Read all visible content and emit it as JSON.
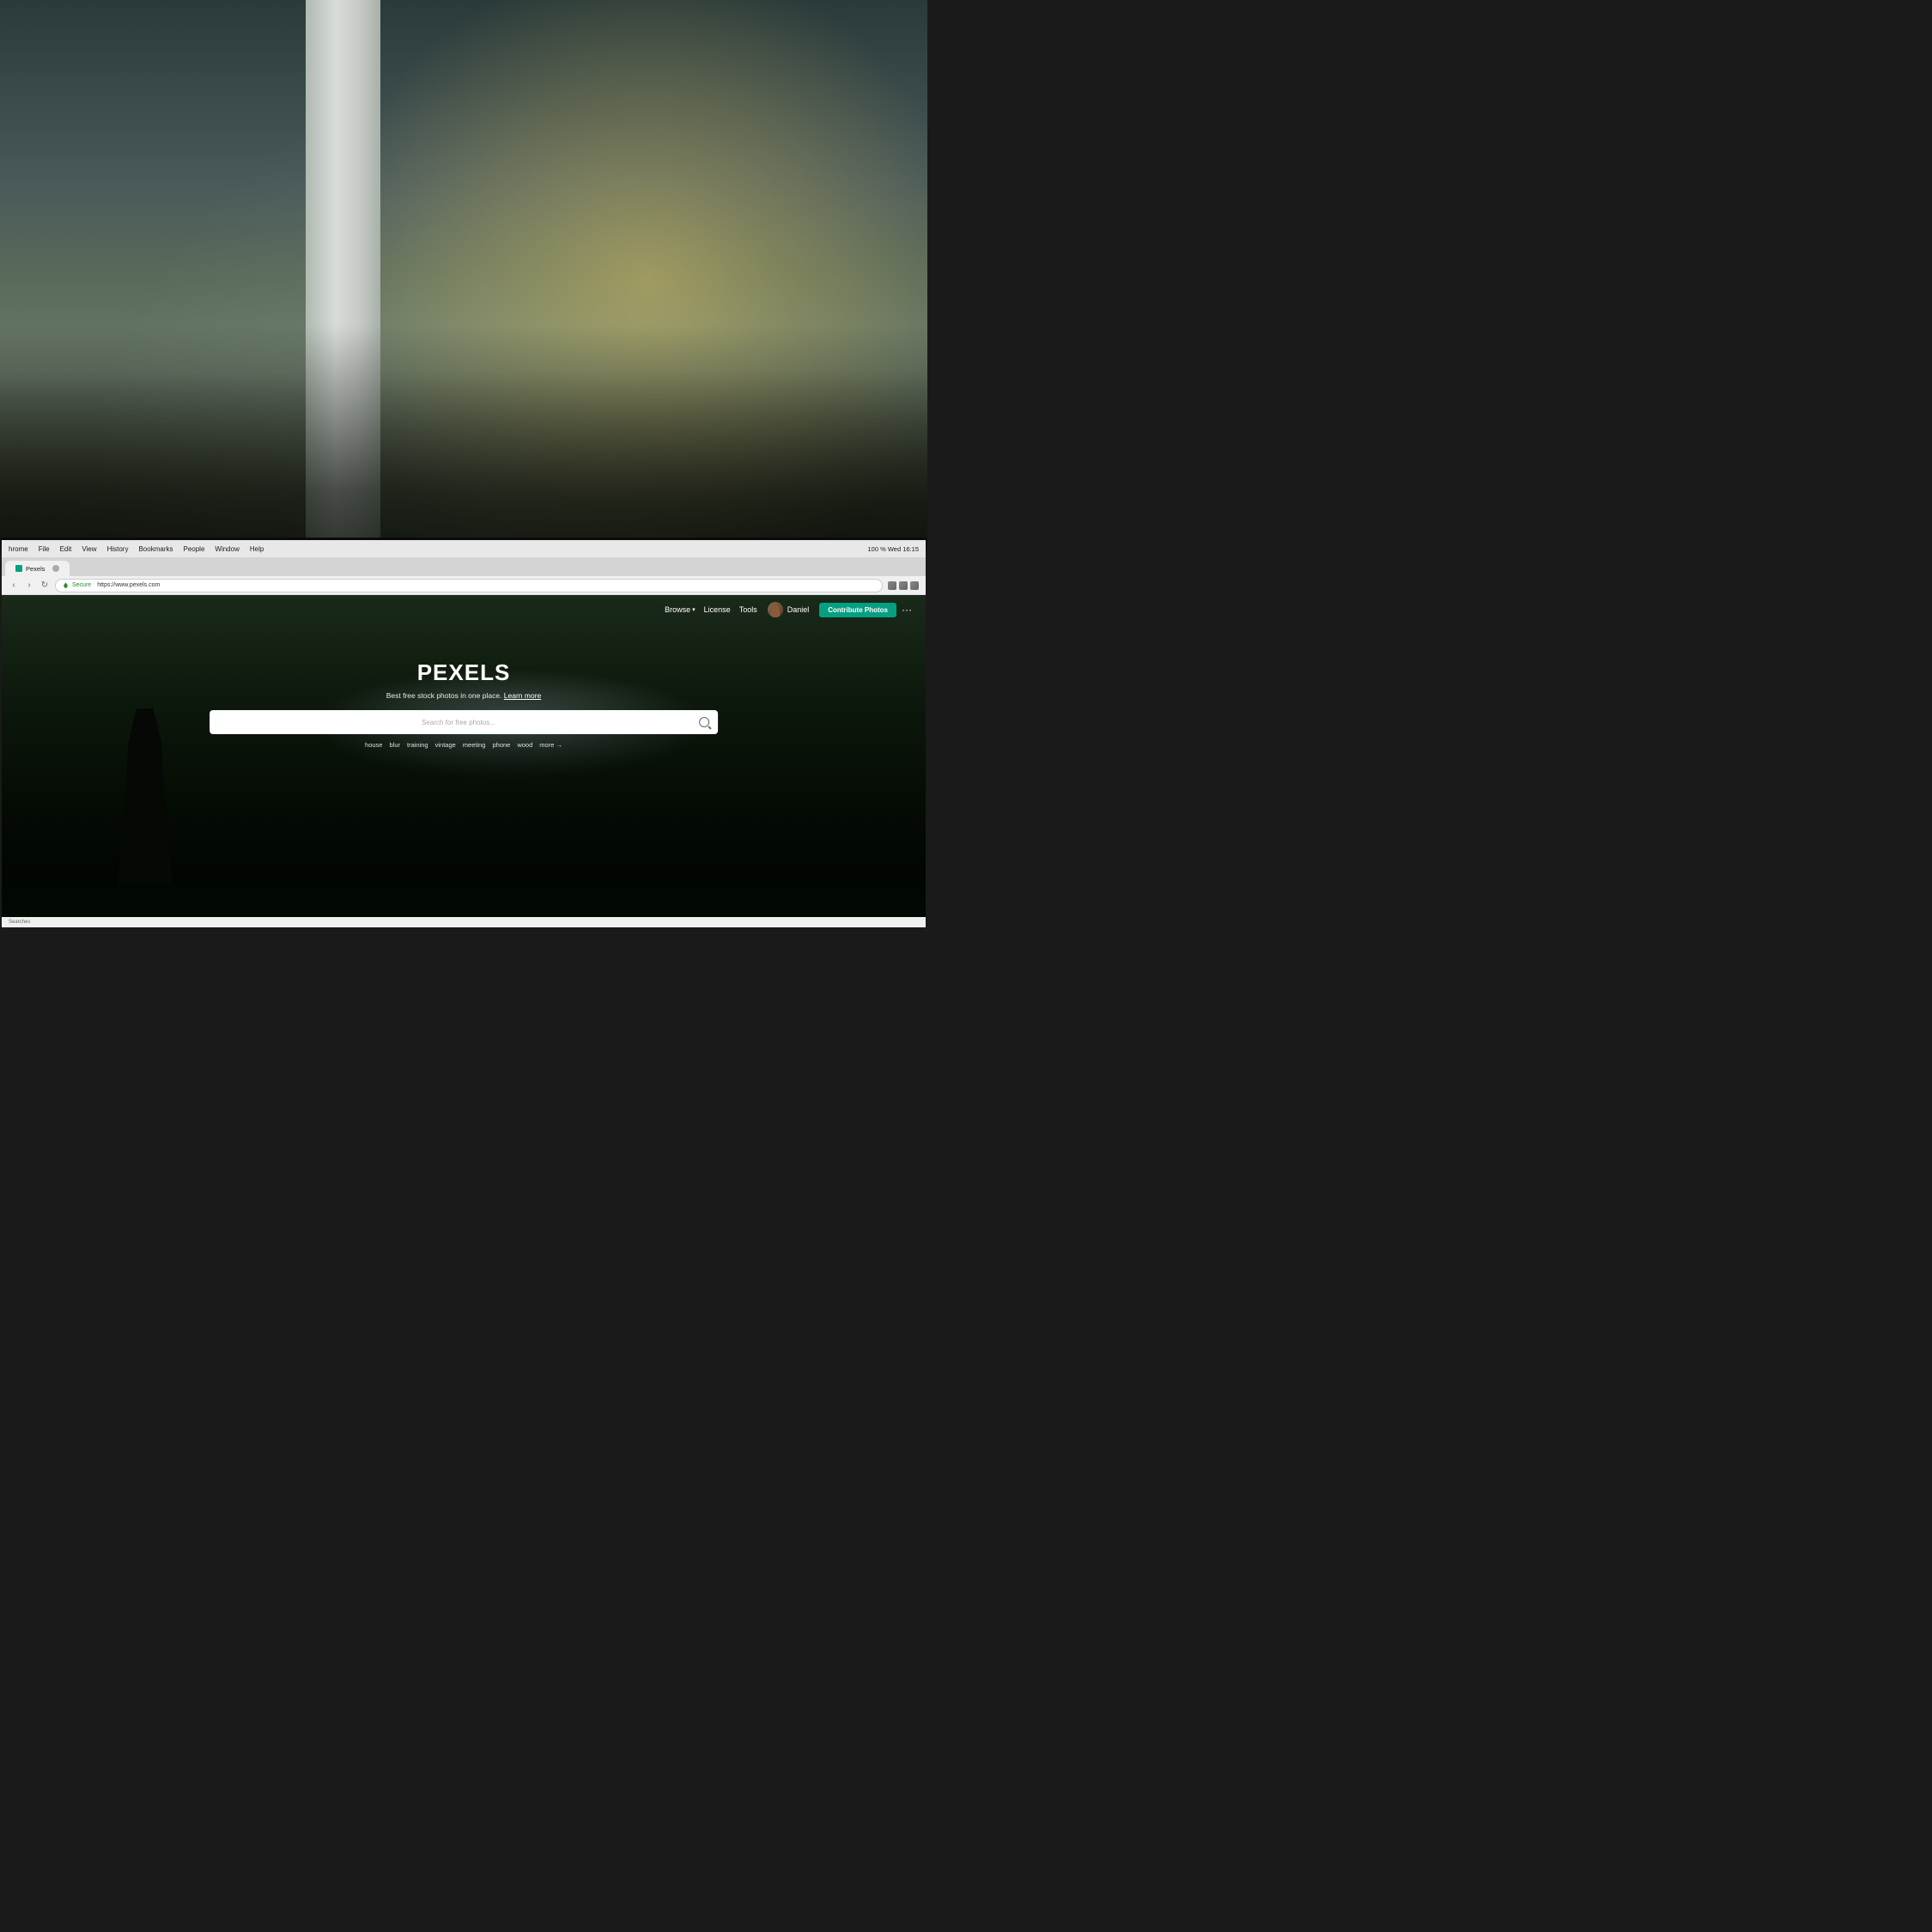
{
  "background": {
    "description": "Office interior with bokeh lighting"
  },
  "monitor": {
    "description": "Laptop/monitor displaying Pexels website"
  },
  "chrome": {
    "menu_items": [
      "hrome",
      "File",
      "Edit",
      "View",
      "History",
      "Bookmarks",
      "People",
      "Window",
      "Help"
    ],
    "status_right": "100 %  Wed 16:15",
    "tab_label": "Pexels",
    "address_secure": "Secure",
    "address_url": "https://www.pexels.com",
    "bottom_status": "Searches"
  },
  "pexels": {
    "nav": {
      "browse_label": "Browse",
      "license_label": "License",
      "tools_label": "Tools",
      "username": "Daniel",
      "contribute_label": "Contribute Photos",
      "more_dots": "···"
    },
    "hero": {
      "logo": "PEXELS",
      "subtitle": "Best free stock photos in one place.",
      "learn_more": "Learn more",
      "search_placeholder": "Search for free photos...",
      "suggestions": [
        "house",
        "blur",
        "training",
        "vintage",
        "meeting",
        "phone",
        "wood"
      ],
      "more_label": "more →"
    }
  }
}
